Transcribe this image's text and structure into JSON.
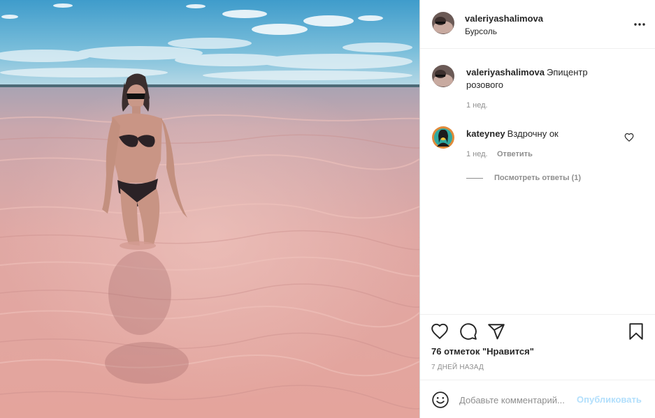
{
  "photo": {
    "alt_icon": "beach-photo",
    "colors": {
      "sky_top": "#3d9ccb",
      "sky_bottom": "#a9d3e6",
      "horizon": "#4a6b77",
      "water_top": "#b8a4ad",
      "water_bottom": "#e2a7a1",
      "swimsuit": "#2b2226"
    }
  },
  "post": {
    "username": "valeriyashalimova",
    "location": "Бурсоль",
    "more_icon": "more-dots-icon"
  },
  "caption": {
    "username": "valeriyashalimova",
    "text": "Эпицентр розового",
    "time": "1 нед."
  },
  "comment": {
    "username": "kateyney",
    "text": "Вздрочну ок",
    "time": "1 нед.",
    "reply_label": "Ответить",
    "like_icon": "heart-outline-icon",
    "view_replies": "Посмотреть ответы (1)"
  },
  "actions": {
    "like_icon": "heart-outline-icon",
    "comment_icon": "comment-bubble-icon",
    "share_icon": "paper-plane-icon",
    "save_icon": "bookmark-icon",
    "likes_text": "76 отметок \"Нравится\"",
    "date_text": "7 ДНЕЙ НАЗАД"
  },
  "add_comment": {
    "emoji_icon": "smiley-icon",
    "placeholder": "Добавьте комментарий...",
    "post_label": "Опубликовать"
  },
  "colors": {
    "text": "#262626",
    "muted": "#8e8e8e",
    "border": "#dbdbdb",
    "post_button_disabled": "#b2dffc"
  }
}
